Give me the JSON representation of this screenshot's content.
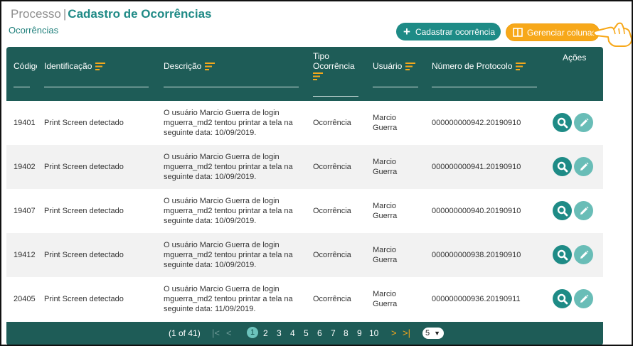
{
  "header": {
    "breadcrumb_parent": "Processo",
    "separator": "|",
    "title": "Cadastro de Ocorrências",
    "subtitle": "Ocorrências"
  },
  "toolbar": {
    "add_label": "Cadastrar ocorrência",
    "manage_columns_label": "Gerenciar colunas"
  },
  "colors": {
    "primary": "#1e8b86",
    "header_bg": "#1e5c57",
    "accent": "#f7a81a",
    "edit": "#69bdb7"
  },
  "table": {
    "columns": {
      "codigo": "Código",
      "identificacao": "Identificação",
      "descricao": "Descrição",
      "tipo_line1": "Tipo",
      "tipo_line2": "Ocorrência",
      "usuario": "Usuário",
      "protocolo": "Número de Protocolo",
      "acoes": "Ações"
    },
    "rows": [
      {
        "codigo": "19401",
        "identificacao": "Print Screen detectado",
        "descricao": "O usuário Marcio Guerra de login mguerra_md2 tentou printar a tela na seguinte data: 10/09/2019.",
        "tipo": "Ocorrência",
        "usuario": "Marcio Guerra",
        "protocolo": "000000000942.20190910"
      },
      {
        "codigo": "19402",
        "identificacao": "Print Screen detectado",
        "descricao": "O usuário Marcio Guerra de login mguerra_md2 tentou printar a tela na seguinte data: 10/09/2019.",
        "tipo": "Ocorrência",
        "usuario": "Marcio Guerra",
        "protocolo": "000000000941.20190910"
      },
      {
        "codigo": "19407",
        "identificacao": "Print Screen detectado",
        "descricao": "O usuário Marcio Guerra de login mguerra_md2 tentou printar a tela na seguinte data: 10/09/2019.",
        "tipo": "Ocorrência",
        "usuario": "Marcio Guerra",
        "protocolo": "000000000940.20190910"
      },
      {
        "codigo": "19412",
        "identificacao": "Print Screen detectado",
        "descricao": "O usuário Marcio Guerra de login mguerra_md2 tentou printar a tela na seguinte data: 10/09/2019.",
        "tipo": "Ocorrência",
        "usuario": "Marcio Guerra",
        "protocolo": "000000000938.20190910"
      },
      {
        "codigo": "20405",
        "identificacao": "Print Screen detectado",
        "descricao": "O usuário Marcio Guerra de login mguerra_md2 tentou printar a tela na seguinte data: 11/09/2019.",
        "tipo": "Ocorrência",
        "usuario": "Marcio Guerra",
        "protocolo": "000000000936.20190911"
      }
    ]
  },
  "pagination": {
    "info": "(1 of 41)",
    "first": "|<",
    "prev": "<",
    "next": ">",
    "last": ">|",
    "pages": [
      "1",
      "2",
      "3",
      "4",
      "5",
      "6",
      "7",
      "8",
      "9",
      "10"
    ],
    "current_page": "1",
    "page_size": "5"
  }
}
